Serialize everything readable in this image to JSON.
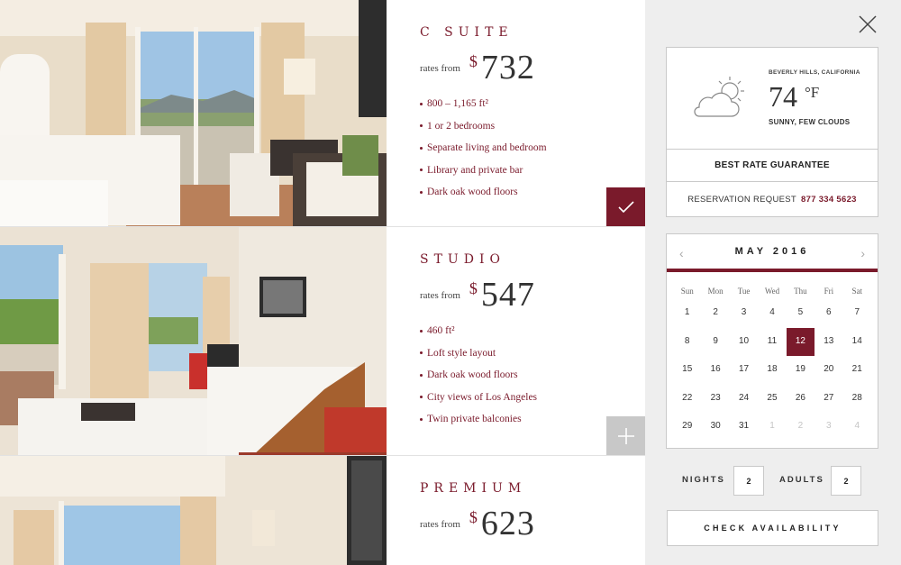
{
  "rooms": [
    {
      "name": "C SUITE",
      "rates_label": "rates from",
      "currency": "$",
      "price": "732",
      "features": [
        "800 – 1,165 ft²",
        "1 or 2 bedrooms",
        "Separate living and bedroom",
        "Library and private bar",
        "Dark oak wood floors"
      ],
      "selected": true
    },
    {
      "name": "STUDIO",
      "rates_label": "rates from",
      "currency": "$",
      "price": "547",
      "features": [
        "460 ft²",
        "Loft style layout",
        "Dark oak wood floors",
        "City views of Los Angeles",
        "Twin private balconies"
      ],
      "selected": false
    },
    {
      "name": "PREMIUM",
      "rates_label": "rates from",
      "currency": "$",
      "price": "623",
      "features": [],
      "selected": false
    }
  ],
  "weather": {
    "city": "BEVERLY HILLS, CALIFORNIA",
    "temperature": "74",
    "unit": "°F",
    "condition": "SUNNY, FEW CLOUDS",
    "icon": "partly-cloudy-icon"
  },
  "best_rate": "BEST RATE GUARANTEE",
  "reservation": {
    "label": "RESERVATION REQUEST",
    "phone": "877 334 5623"
  },
  "calendar": {
    "month": "MAY 2016",
    "days_of_week": [
      "Sun",
      "Mon",
      "Tue",
      "Wed",
      "Thu",
      "Fri",
      "Sat"
    ],
    "weeks": [
      [
        "1",
        "2",
        "3",
        "4",
        "5",
        "6",
        "7"
      ],
      [
        "8",
        "9",
        "10",
        "11",
        "12",
        "13",
        "14"
      ],
      [
        "15",
        "16",
        "17",
        "18",
        "19",
        "20",
        "21"
      ],
      [
        "22",
        "23",
        "24",
        "25",
        "26",
        "27",
        "28"
      ],
      [
        "29",
        "30",
        "31",
        "1",
        "2",
        "3",
        "4"
      ]
    ],
    "selected_day": "12"
  },
  "nights": {
    "label": "NIGHTS",
    "value": "2"
  },
  "adults": {
    "label": "ADULTS",
    "value": "2"
  },
  "check_availability": "CHECK AVAILABILITY",
  "colors": {
    "accent": "#7a1a2b",
    "sidebar_bg": "#eeeeee",
    "add_button": "#c8c8c8"
  }
}
